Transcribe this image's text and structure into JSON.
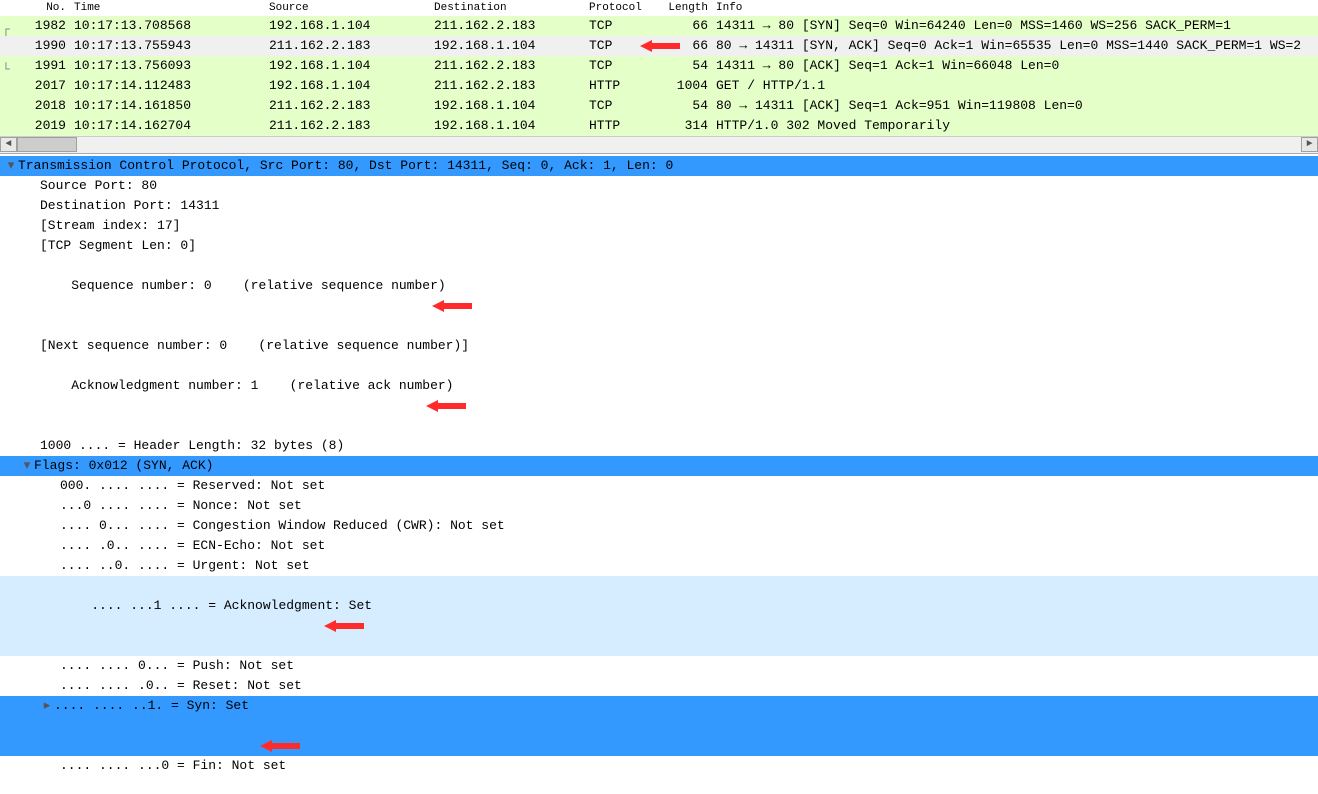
{
  "packet_list": {
    "headers": {
      "no": "No.",
      "time": "Time",
      "source": "Source",
      "destination": "Destination",
      "protocol": "Protocol",
      "length": "Length",
      "info": "Info"
    },
    "rows": [
      {
        "no": "1982",
        "time": "10:17:13.708568",
        "src": "192.168.1.104",
        "dst": "211.162.2.183",
        "proto": "TCP",
        "len": "66",
        "info": "14311 → 80 [SYN] Seq=0 Win=64240 Len=0 MSS=1460 WS=256 SACK_PERM=1"
      },
      {
        "no": "1990",
        "time": "10:17:13.755943",
        "src": "211.162.2.183",
        "dst": "192.168.1.104",
        "proto": "TCP",
        "len": "66",
        "info": "80 → 14311 [SYN, ACK] Seq=0 Ack=1 Win=65535 Len=0 MSS=1440 SACK_PERM=1 WS=2"
      },
      {
        "no": "1991",
        "time": "10:17:13.756093",
        "src": "192.168.1.104",
        "dst": "211.162.2.183",
        "proto": "TCP",
        "len": "54",
        "info": "14311 → 80 [ACK] Seq=1 Ack=1 Win=66048 Len=0"
      },
      {
        "no": "2017",
        "time": "10:17:14.112483",
        "src": "192.168.1.104",
        "dst": "211.162.2.183",
        "proto": "HTTP",
        "len": "1004",
        "info": "GET / HTTP/1.1"
      },
      {
        "no": "2018",
        "time": "10:17:14.161850",
        "src": "211.162.2.183",
        "dst": "192.168.1.104",
        "proto": "TCP",
        "len": "54",
        "info": "80 → 14311 [ACK] Seq=1 Ack=951 Win=119808 Len=0"
      },
      {
        "no": "2019",
        "time": "10:17:14.162704",
        "src": "211.162.2.183",
        "dst": "192.168.1.104",
        "proto": "HTTP",
        "len": "314",
        "info": "HTTP/1.0 302 Moved Temporarily"
      }
    ]
  },
  "detail": {
    "tcp_title": "Transmission Control Protocol, Src Port: 80, Dst Port: 14311, Seq: 0, Ack: 1, Len: 0",
    "src_port": "Source Port: 80",
    "dst_port": "Destination Port: 14311",
    "stream_idx": "[Stream index: 17]",
    "seg_len": "[TCP Segment Len: 0]",
    "seq_num": "Sequence number: 0    (relative sequence number)",
    "next_seq": "[Next sequence number: 0    (relative sequence number)]",
    "ack_num": "Acknowledgment number: 1    (relative ack number)",
    "hdr_len": "1000 .... = Header Length: 32 bytes (8)",
    "flags_title": "Flags: 0x012 (SYN, ACK)",
    "flag_reserved": "000. .... .... = Reserved: Not set",
    "flag_nonce": "...0 .... .... = Nonce: Not set",
    "flag_cwr": ".... 0... .... = Congestion Window Reduced (CWR): Not set",
    "flag_ecn": ".... .0.. .... = ECN-Echo: Not set",
    "flag_urg": ".... ..0. .... = Urgent: Not set",
    "flag_ack": ".... ...1 .... = Acknowledgment: Set",
    "flag_push": ".... .... 0... = Push: Not set",
    "flag_reset": ".... .... .0.. = Reset: Not set",
    "flag_syn": ".... .... ..1. = Syn: Set",
    "flag_fin": ".... .... ...0 = Fin: Not set"
  }
}
